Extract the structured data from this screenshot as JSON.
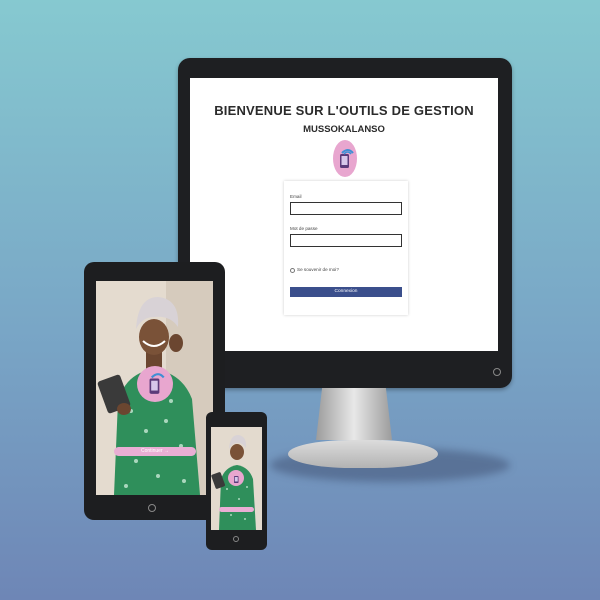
{
  "login": {
    "title": "BIENVENUE SUR L'OUTILS DE GESTION",
    "subtitle": "MUSSOKALANSO",
    "email_label": "Email",
    "email_value": "",
    "password_label": "Mot de passe",
    "password_value": "",
    "remember_label": "Se souvenir de moi?",
    "submit_label": "Connexion"
  },
  "tablet": {
    "continue_label": "Continuer →"
  },
  "icons": {
    "logo": "phone-with-wifi-icon",
    "continue_arrow": "arrow-right-icon"
  },
  "colors": {
    "background_top": "#86c9d0",
    "background_bottom": "#6e86b6",
    "accent_pink": "#e9aed4",
    "button_blue": "#3b4f8c",
    "dress_green": "#2f8f5b"
  }
}
